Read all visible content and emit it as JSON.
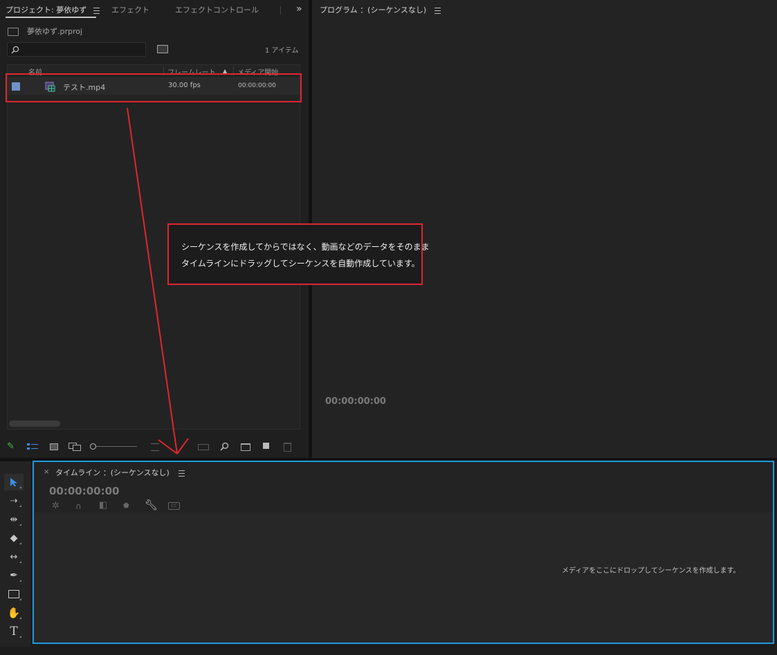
{
  "project_panel": {
    "tabs": [
      {
        "label": "プロジェクト: 夢依ゆず"
      },
      {
        "label": "エフェクト"
      },
      {
        "label": "エフェクトコントロール"
      }
    ],
    "project_file": "夢依ゆず.prproj",
    "search_placeholder": "",
    "item_count": "1 アイテム",
    "columns": [
      "名前",
      "フレームレート",
      "メディア開始"
    ],
    "rows": [
      {
        "name": "テスト.mp4",
        "frame_rate": "30.00 fps",
        "media_start": "00:00:00:00"
      }
    ]
  },
  "program_monitor": {
    "title": "プログラム ：(シーケンスなし)",
    "timecode": "00:00:00:00"
  },
  "timeline": {
    "title": "タイムライン ：(シーケンスなし)",
    "timecode": "00:00:00:00",
    "drop_hint": "メディアをここにドロップしてシーケンスを作成します。"
  },
  "annotation": {
    "line1": "シーケンスを作成してからではなく、動画などのデータをそのまま",
    "line2": "タイムラインにドラッグしてシーケンスを自動作成しています。"
  },
  "colors": {
    "highlight_red": "#e0262e",
    "highlight_blue": "#1e9be0",
    "label_swatch": "#6f93c9"
  },
  "icons": {
    "panel_overflow": "double-chevron-right-icon",
    "tools": [
      "selection-tool-icon",
      "track-select-tool-icon",
      "ripple-edit-tool-icon",
      "razor-tool-icon",
      "slip-tool-icon",
      "pen-tool-icon",
      "rectangle-tool-icon",
      "hand-tool-icon",
      "type-tool-icon"
    ]
  }
}
